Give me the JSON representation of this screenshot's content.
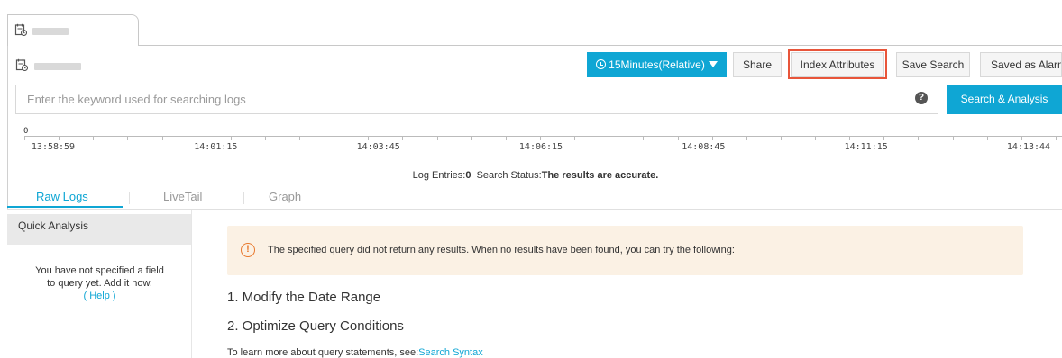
{
  "toolbar": {
    "time_range_label": "15Minutes(Relative)",
    "share_label": "Share",
    "index_attributes_label": "Index Attributes",
    "save_search_label": "Save Search",
    "saved_as_alarm_label": "Saved as Alarm"
  },
  "search": {
    "placeholder": "Enter the keyword used for searching logs",
    "help_glyph": "?",
    "button_label": "Search & Analysis"
  },
  "timeline": {
    "zero_label": "0",
    "ticks": [
      "13:58:59",
      "14:01:15",
      "14:03:45",
      "14:06:15",
      "14:08:45",
      "14:11:15",
      "14:13:44"
    ]
  },
  "status": {
    "entries_label": "Log Entries:",
    "entries_value": "0",
    "status_label": "Search Status:",
    "status_value": "The results are accurate."
  },
  "tabs": [
    {
      "label": "Raw Logs",
      "active": true
    },
    {
      "label": "LiveTail",
      "active": false
    },
    {
      "label": "Graph",
      "active": false
    }
  ],
  "sidebar": {
    "title": "Quick Analysis",
    "message_line1": "You have not specified a field",
    "message_line2": "to query yet. Add it now.",
    "help_link": "( Help )"
  },
  "notice": {
    "icon_glyph": "!",
    "text": "The specified query did not return any results. When no results have been found, you can try the following:"
  },
  "suggestions": {
    "step1": "1. Modify the Date Range",
    "step2": "2. Optimize Query Conditions",
    "learn_more_prefix": "To learn more about query statements, see:",
    "learn_more_link": "Search Syntax"
  },
  "colors": {
    "accent": "#0fa6d4",
    "highlight": "#e8553a",
    "warning_bg": "#fbf1e4",
    "warning_icon": "#e8792e"
  },
  "icons": {
    "logstore_tab": "logstore-icon",
    "logstore_header": "logstore-icon",
    "time": "clock-icon",
    "dropdown": "caret-down-icon",
    "help": "help-icon",
    "warning": "warning-icon"
  }
}
